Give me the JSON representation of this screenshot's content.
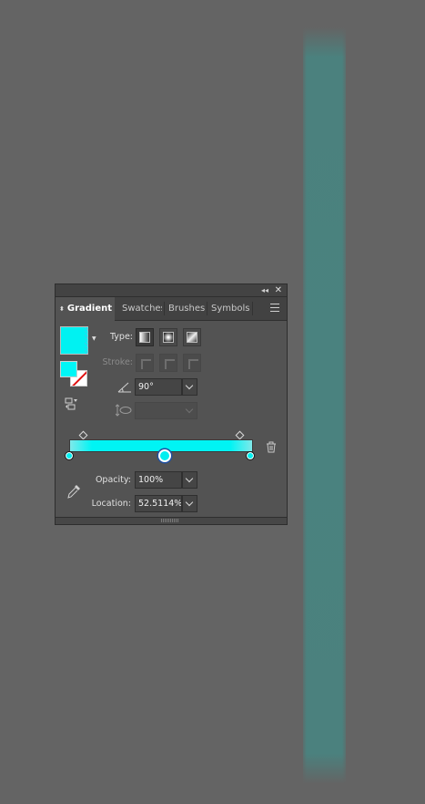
{
  "panel": {
    "tabs": [
      {
        "label": "Gradient",
        "active": true
      },
      {
        "label": "Swatches",
        "active": false
      },
      {
        "label": "Brushes",
        "active": false
      },
      {
        "label": "Symbols",
        "active": false
      }
    ],
    "controls": {
      "type_label": "Type:",
      "type_selected": "linear",
      "stroke_label": "Stroke:",
      "angle_value": "90°",
      "aspect_value": ""
    },
    "gradient": {
      "fill_color": "#00F2F2",
      "stop_color": "#00F2F2",
      "midpoint_location_percent": 52.5114
    },
    "opacity": {
      "label": "Opacity:",
      "value": "100%"
    },
    "location": {
      "label": "Location:",
      "value": "52.5114%"
    }
  },
  "canvas": {
    "strip_color": "#4B817E"
  },
  "icons": [
    "sort-icon",
    "menu-icon",
    "swap-icon",
    "angle-icon",
    "aspect-ratio-icon",
    "trash-icon",
    "eyedropper-icon",
    "collapse-icon",
    "close-icon"
  ]
}
